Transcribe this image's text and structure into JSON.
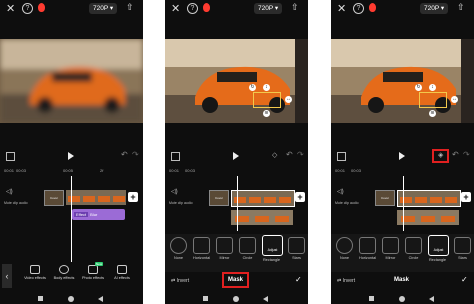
{
  "common": {
    "resolution": "720P ▾",
    "close": "✕",
    "help": "?",
    "export": "⇧",
    "undo": "↶",
    "redo": "↷",
    "ruler": [
      "00:01",
      "00:03",
      "2f",
      "00:05",
      "2f"
    ],
    "mute_label": "Mute clip audio",
    "cover_label": "Cover",
    "add": "+"
  },
  "panel1": {
    "effect_tag": "Effect",
    "effect_name": "Blur",
    "back": "‹",
    "tools": [
      {
        "label": "Video effects",
        "icon": "video-effects-icon"
      },
      {
        "label": "Body effects",
        "icon": "body-effects-icon"
      },
      {
        "label": "Photo effects",
        "icon": "photo-effects-icon",
        "badge": "New"
      },
      {
        "label": "AI effects",
        "icon": "ai-effects-icon"
      }
    ]
  },
  "masks": [
    {
      "label": "None",
      "icon": "none-icon"
    },
    {
      "label": "Horizontal",
      "icon": "horizontal-icon"
    },
    {
      "label": "Mirror",
      "icon": "mirror-icon"
    },
    {
      "label": "Circle",
      "icon": "circle-icon"
    },
    {
      "label": "Rectangle",
      "icon": "rectangle-icon",
      "selected": true
    },
    {
      "label": "Stars",
      "icon": "stars-icon"
    }
  ],
  "panel2": {
    "mask_title": "Mask",
    "invert": "Invert",
    "confirm": "✓",
    "adjust": "Adjust"
  },
  "panel3": {
    "mask_title": "Mask",
    "invert": "Invert",
    "confirm": "✓",
    "adjust": "Adjust"
  },
  "colors": {
    "highlight": "#e02020",
    "effect": "#9b6bd6",
    "accent": "#ff3b30"
  }
}
